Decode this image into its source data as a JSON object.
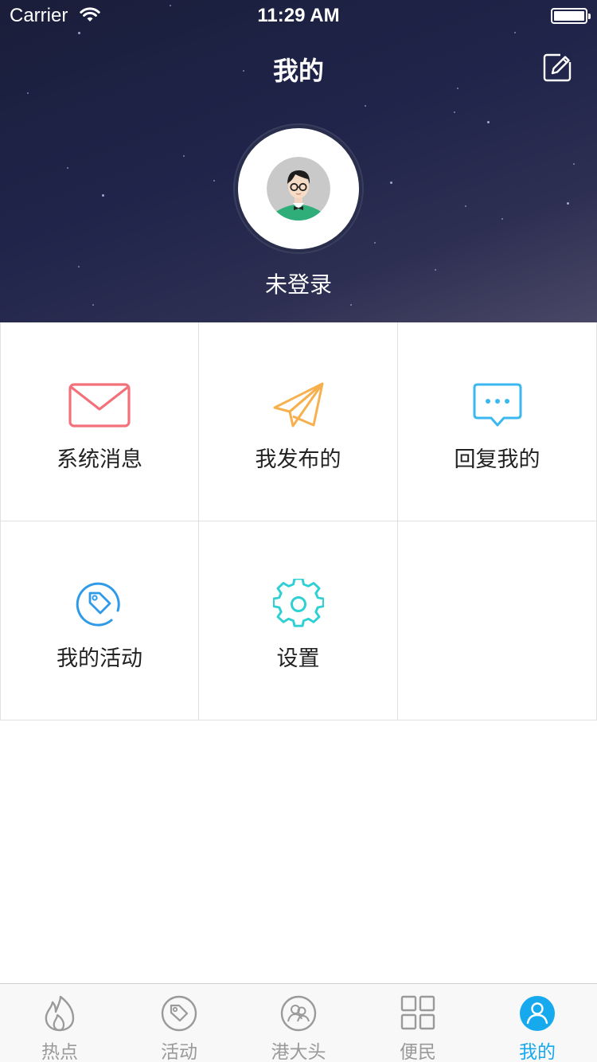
{
  "status_bar": {
    "carrier": "Carrier",
    "time": "11:29 AM"
  },
  "header": {
    "title": "我的",
    "edit_icon": "edit-icon"
  },
  "profile": {
    "login_status": "未登录",
    "avatar_icon": "user-avatar-icon"
  },
  "menu": [
    {
      "label": "系统消息",
      "icon": "envelope-icon",
      "color": "#f2717a"
    },
    {
      "label": "我发布的",
      "icon": "paper-plane-icon",
      "color": "#f7b04e"
    },
    {
      "label": "回复我的",
      "icon": "chat-bubble-icon",
      "color": "#3bb8f0"
    },
    {
      "label": "我的活动",
      "icon": "tag-icon",
      "color": "#2f9be8"
    },
    {
      "label": "设置",
      "icon": "gear-icon",
      "color": "#2fd0d4"
    }
  ],
  "tabbar": {
    "active_color": "#17a9ee",
    "inactive_color": "#9a9a9a",
    "items": [
      {
        "label": "热点",
        "icon": "flame-icon"
      },
      {
        "label": "活动",
        "icon": "tag-icon"
      },
      {
        "label": "港大头",
        "icon": "people-icon"
      },
      {
        "label": "便民",
        "icon": "grid-icon"
      },
      {
        "label": "我的",
        "icon": "user-icon",
        "active": true
      }
    ]
  }
}
